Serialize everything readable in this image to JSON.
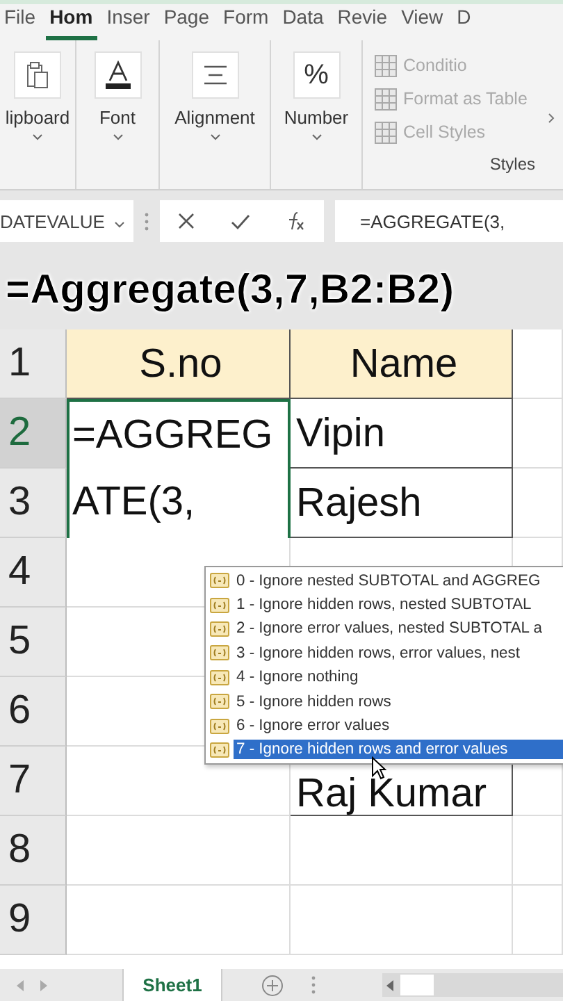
{
  "ribbon_tabs": [
    {
      "label": "File",
      "selected": false
    },
    {
      "label": "Hom",
      "selected": true
    },
    {
      "label": "Inser",
      "selected": false
    },
    {
      "label": "Page",
      "selected": false
    },
    {
      "label": "Form",
      "selected": false
    },
    {
      "label": "Data",
      "selected": false
    },
    {
      "label": "Revie",
      "selected": false
    },
    {
      "label": "View",
      "selected": false
    },
    {
      "label": "D",
      "selected": false
    }
  ],
  "ribbon_groups": [
    {
      "kind": "clipboard",
      "label": "lipboard"
    },
    {
      "kind": "font",
      "label": "Font"
    },
    {
      "kind": "alignment",
      "label": "Alignment"
    },
    {
      "kind": "number",
      "label": "Number",
      "glyph": "%"
    }
  ],
  "styles_group": {
    "label": "Styles",
    "items": [
      "Conditio",
      "Format as Table",
      "Cell Styles"
    ]
  },
  "formula_bar": {
    "name_box": "DATEVALUE",
    "formula": "=AGGREGATE(3,"
  },
  "caption": "=Aggregate(3,7,B2:B2)",
  "rows": [
    {
      "header": "1",
      "a": "S.no",
      "b": "Name",
      "heading": true
    },
    {
      "header": "2",
      "a": "",
      "b": "Vipin",
      "heading": false
    },
    {
      "header": "3",
      "a": "",
      "b": "Rajesh",
      "heading": false
    },
    {
      "header": "4",
      "a": "",
      "b": "",
      "heading": false
    },
    {
      "header": "5",
      "a": "",
      "b": "",
      "heading": false
    },
    {
      "header": "6",
      "a": "",
      "b": "",
      "heading": false
    },
    {
      "header": "7",
      "a": "",
      "b": "Raj Kumar",
      "heading": false
    },
    {
      "header": "8",
      "a": "",
      "b": "",
      "heading": false
    },
    {
      "header": "9",
      "a": "",
      "b": "",
      "heading": false
    }
  ],
  "editor_lines": [
    "=AGGREG",
    "ATE(3,"
  ],
  "autocomplete": [
    {
      "label": "0 - Ignore nested SUBTOTAL and AGGREG",
      "selected": false
    },
    {
      "label": "1 - Ignore hidden rows, nested SUBTOTAL",
      "selected": false
    },
    {
      "label": "2 - Ignore error values, nested SUBTOTAL a",
      "selected": false
    },
    {
      "label": "3 - Ignore hidden rows, error values, nest",
      "selected": false
    },
    {
      "label": "4 - Ignore nothing",
      "selected": false
    },
    {
      "label": "5 - Ignore hidden rows",
      "selected": false
    },
    {
      "label": "6 - Ignore error values",
      "selected": false
    },
    {
      "label": "7 - Ignore hidden rows and error values",
      "selected": true
    }
  ],
  "sheet_tabs": [
    {
      "label": "Sheet1",
      "selected": true
    }
  ]
}
